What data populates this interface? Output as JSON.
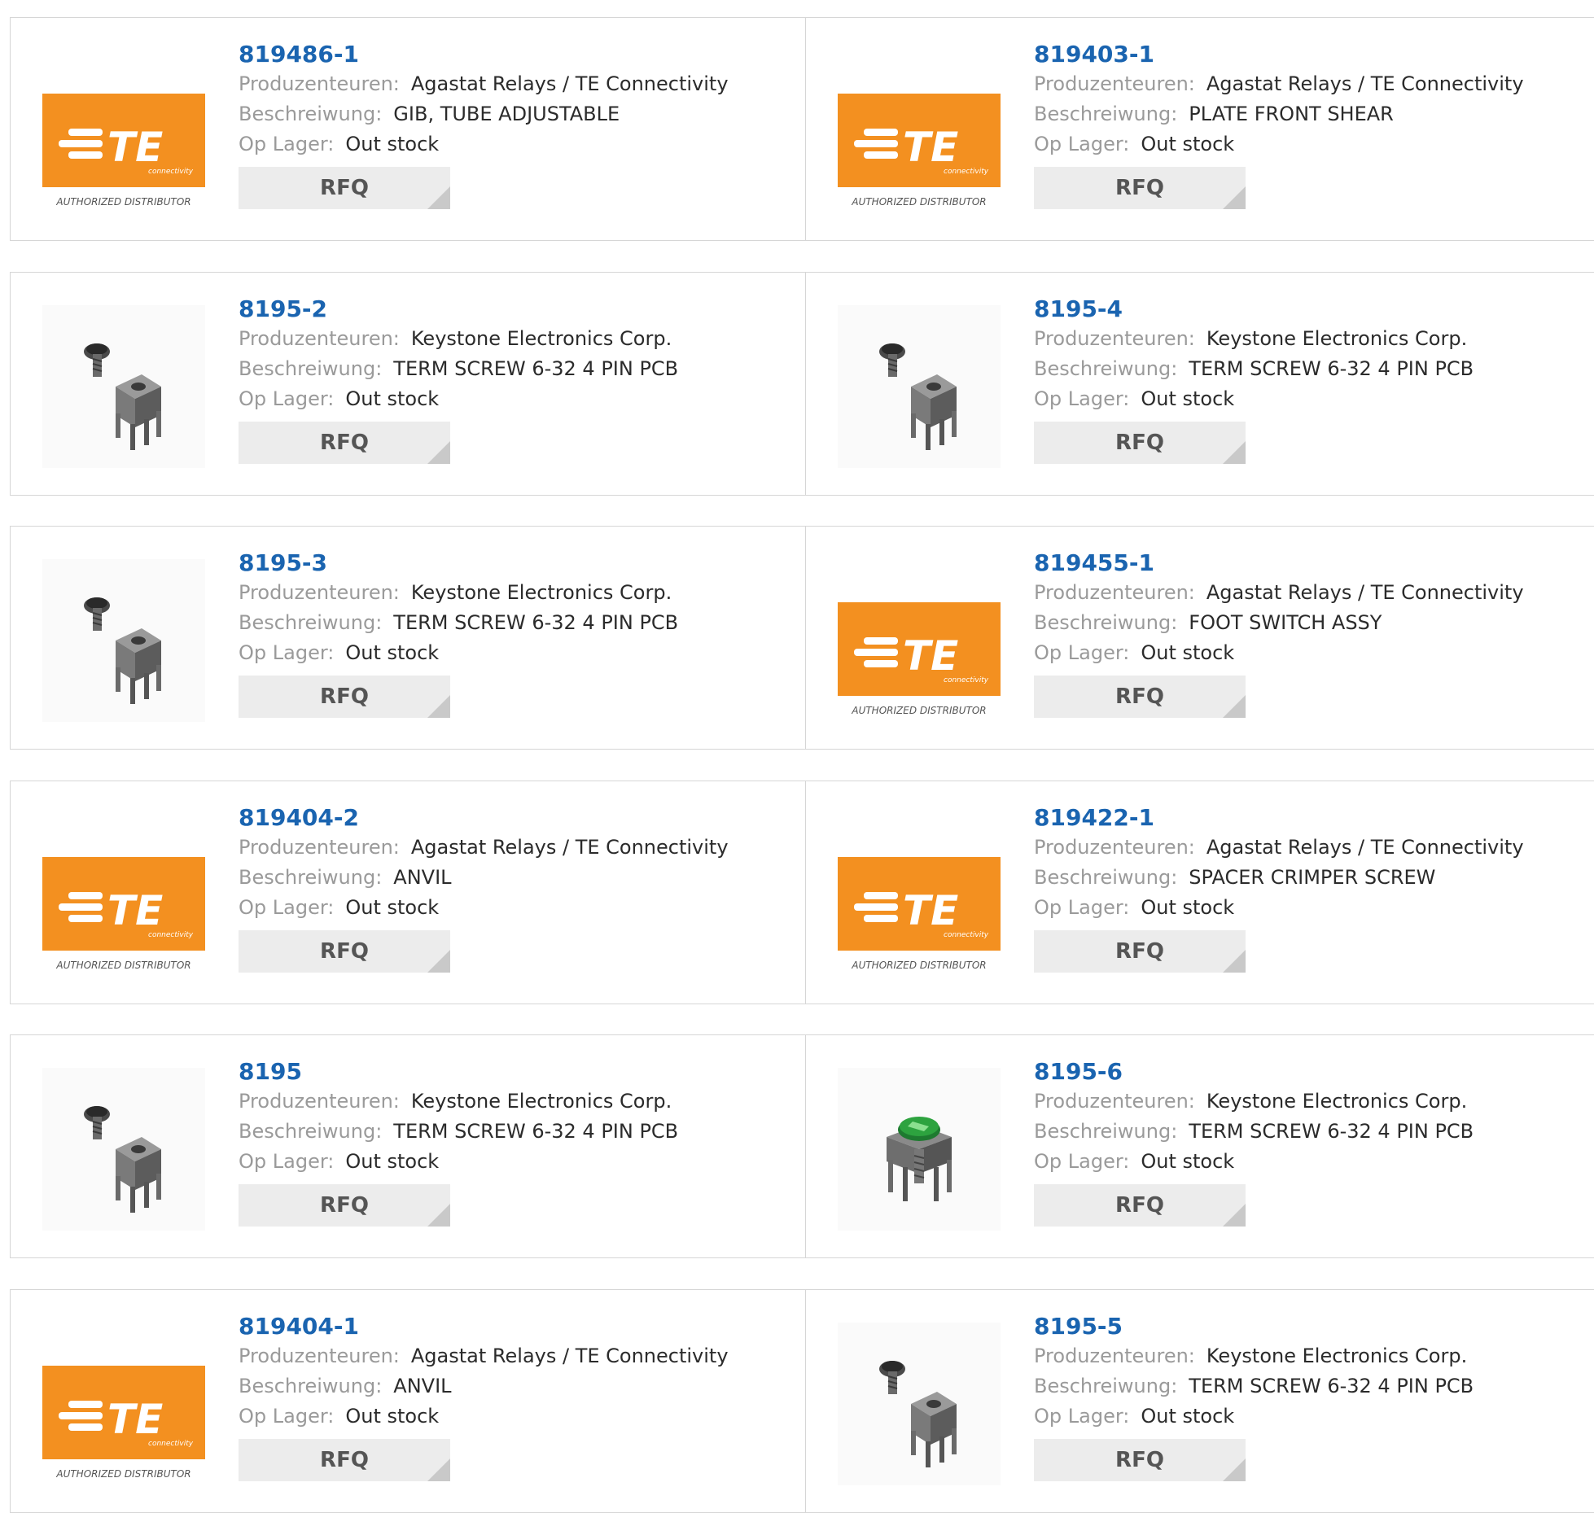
{
  "labels": {
    "manufacturer": "Produzenteuren:",
    "description": "Beschreiwung:",
    "stock": "Op Lager:",
    "rfq": "RFQ"
  },
  "logo": {
    "brand_text": "TE",
    "sub_text": "connectivity",
    "tagline": "AUTHORIZED DISTRIBUTOR",
    "orange": "#f39020"
  },
  "products": [
    {
      "part": "819486-1",
      "manufacturer": "Agastat Relays / TE Connectivity",
      "description": "GIB, TUBE ADJUSTABLE",
      "stock": "Out stock",
      "image": "te-logo"
    },
    {
      "part": "819403-1",
      "manufacturer": "Agastat Relays / TE Connectivity",
      "description": "PLATE FRONT SHEAR",
      "stock": "Out stock",
      "image": "te-logo"
    },
    {
      "part": "8195-2",
      "manufacturer": "Keystone Electronics Corp.",
      "description": "TERM SCREW 6-32 4 PIN PCB",
      "stock": "Out stock",
      "image": "screw-terminal"
    },
    {
      "part": "8195-4",
      "manufacturer": "Keystone Electronics Corp.",
      "description": "TERM SCREW 6-32 4 PIN PCB",
      "stock": "Out stock",
      "image": "screw-terminal"
    },
    {
      "part": "8195-3",
      "manufacturer": "Keystone Electronics Corp.",
      "description": "TERM SCREW 6-32 4 PIN PCB",
      "stock": "Out stock",
      "image": "screw-terminal"
    },
    {
      "part": "819455-1",
      "manufacturer": "Agastat Relays / TE Connectivity",
      "description": "FOOT SWITCH ASSY",
      "stock": "Out stock",
      "image": "te-logo"
    },
    {
      "part": "819404-2",
      "manufacturer": "Agastat Relays / TE Connectivity",
      "description": "ANVIL",
      "stock": "Out stock",
      "image": "te-logo"
    },
    {
      "part": "819422-1",
      "manufacturer": "Agastat Relays / TE Connectivity",
      "description": "SPACER CRIMPER SCREW",
      "stock": "Out stock",
      "image": "te-logo"
    },
    {
      "part": "8195",
      "manufacturer": "Keystone Electronics Corp.",
      "description": "TERM SCREW 6-32 4 PIN PCB",
      "stock": "Out stock",
      "image": "screw-terminal"
    },
    {
      "part": "8195-6",
      "manufacturer": "Keystone Electronics Corp.",
      "description": "TERM SCREW 6-32 4 PIN PCB",
      "stock": "Out stock",
      "image": "green-screw-terminal"
    },
    {
      "part": "819404-1",
      "manufacturer": "Agastat Relays / TE Connectivity",
      "description": "ANVIL",
      "stock": "Out stock",
      "image": "te-logo"
    },
    {
      "part": "8195-5",
      "manufacturer": "Keystone Electronics Corp.",
      "description": "TERM SCREW 6-32 4 PIN PCB",
      "stock": "Out stock",
      "image": "screw-terminal"
    }
  ]
}
